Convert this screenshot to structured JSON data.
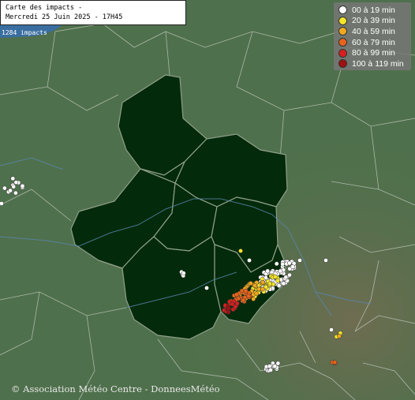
{
  "title": {
    "line1": "Carte des impacts -",
    "line2": "Mercredi 25 Juin 2025 - 17H45"
  },
  "impact_count": "1284 impacts",
  "legend": [
    {
      "label": "00 à 19 min",
      "color": "#ffffff"
    },
    {
      "label": "20 à 39 min",
      "color": "#f5e62a"
    },
    {
      "label": "40 à 59 min",
      "color": "#f0a81e"
    },
    {
      "label": "60 à 79 min",
      "color": "#e8641a"
    },
    {
      "label": "80 à 99 min",
      "color": "#d81e1e"
    },
    {
      "label": "100 à 119 min",
      "color": "#a01010"
    }
  ],
  "credit": "© Association Météo Centre - DonneesMétéo"
}
